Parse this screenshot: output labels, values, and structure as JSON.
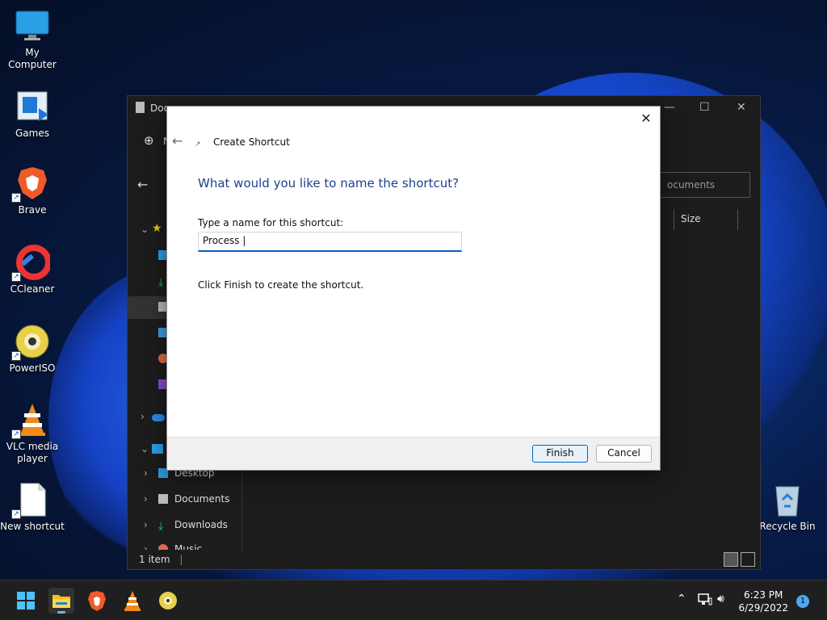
{
  "desktop": {
    "icons": [
      {
        "label": "My Computer",
        "icon": "monitor-icon"
      },
      {
        "label": "Games",
        "icon": "games-folder-icon"
      },
      {
        "label": "Brave",
        "icon": "brave-lion-icon"
      },
      {
        "label": "CCleaner",
        "icon": "ccleaner-icon"
      },
      {
        "label": "PowerISO",
        "icon": "disc-icon"
      },
      {
        "label": "VLC media player",
        "icon": "vlc-cone-icon"
      },
      {
        "label": "New shortcut",
        "icon": "blank-file-icon"
      },
      {
        "label": "Recycle Bin",
        "icon": "recycle-bin-icon"
      }
    ]
  },
  "explorer": {
    "title": "Documents",
    "title_visible": "Doc",
    "new_label": "N",
    "search_placeholder": "Search Documents",
    "search_visible": "ocuments",
    "column_size": "Size",
    "sidebar": [
      {
        "label": "Desktop"
      },
      {
        "label": "Documents"
      },
      {
        "label": "Downloads"
      },
      {
        "label": "Music"
      }
    ],
    "status": "1 item"
  },
  "dialog": {
    "title": "Create Shortcut",
    "question": "What would you like to name the shortcut?",
    "name_label": "Type a name for this shortcut:",
    "name_value": "Process |",
    "finish_hint": "Click Finish to create the shortcut.",
    "finish_label": "Finish",
    "cancel_label": "Cancel",
    "close_glyph": "✕",
    "back_glyph": "←"
  },
  "taskbar": {
    "time": "6:23 PM",
    "date": "6/29/2022",
    "notification_count": "1",
    "accent": "#6cb4f2"
  }
}
